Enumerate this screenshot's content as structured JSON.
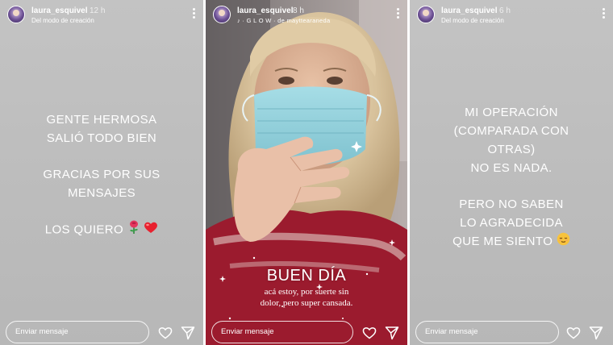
{
  "stories": [
    {
      "username": "laura_esquivel",
      "time": "12 h",
      "subtitle": "Del modo de creación",
      "caption_lines": [
        "GENTE HERMOSA",
        "SALIÓ TODO BIEN",
        "",
        "GRACIAS POR SUS",
        "MENSAJES",
        "",
        "LOS QUIERO"
      ],
      "message_placeholder": "Enviar mensaje"
    },
    {
      "username": "laura_esquivel",
      "time": "8 h",
      "music_tag": "♪ · G L O W · de mayttearaneda",
      "title": "BUEN DÍA",
      "text_line1": "acá estoy, por suerte sin",
      "text_line2": "dolor, pero super cansada.",
      "message_placeholder": "Enviar mensaje"
    },
    {
      "username": "laura_esquivel",
      "time": "6 h",
      "subtitle": "Del modo de creación",
      "caption_lines": [
        "MI OPERACIÓN",
        "(COMPARADA CON",
        "OTRAS)",
        "NO ES NADA.",
        "",
        "PERO NO SABEN",
        "LO AGRADECIDA",
        "QUE ME SIENTO"
      ],
      "message_placeholder": "Enviar mensaje"
    }
  ],
  "colors": {
    "text_bg": "#bdbdbd",
    "shirt": "#9b1b2e",
    "mask": "#8fd0dc"
  },
  "icons": [
    "more-options-icon",
    "heart-icon",
    "send-icon",
    "rose-emoji",
    "red-heart-emoji",
    "relieved-face-emoji",
    "music-note-icon"
  ]
}
